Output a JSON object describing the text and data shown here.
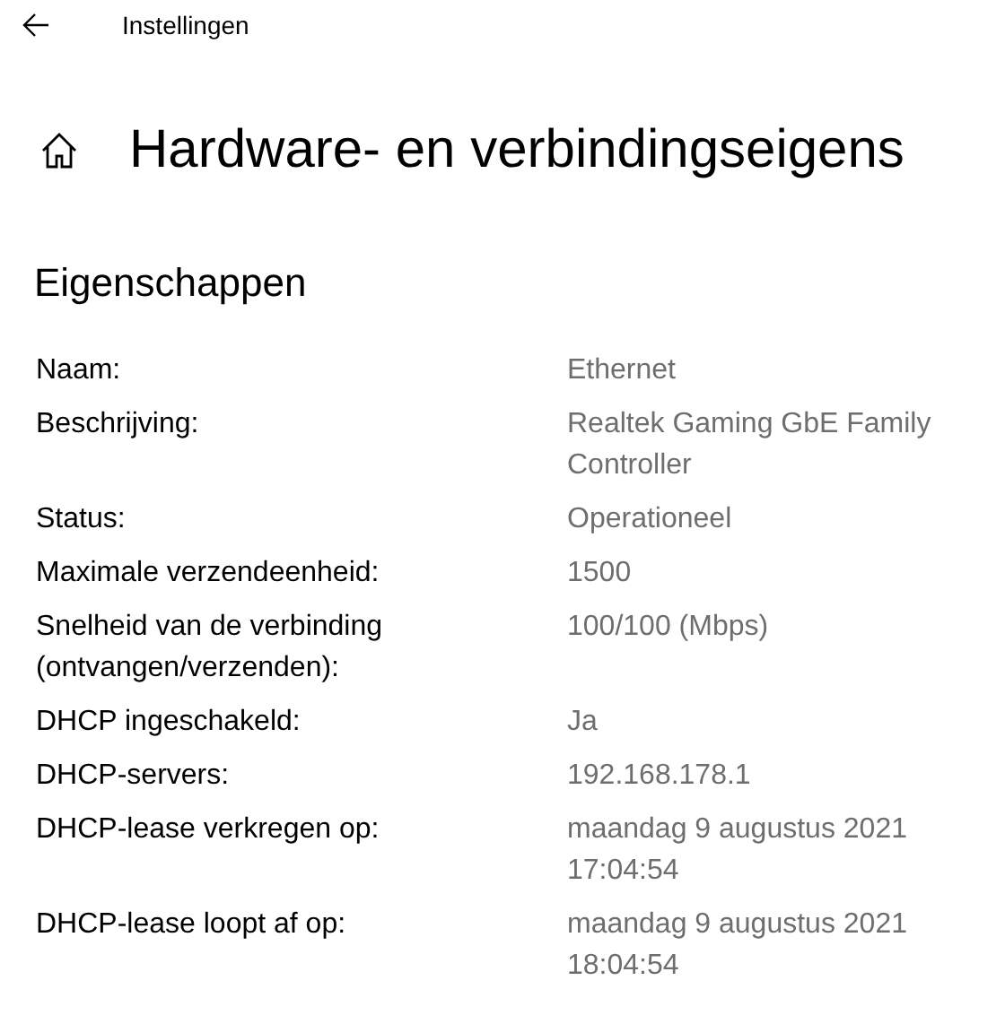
{
  "header": {
    "title": "Instellingen"
  },
  "page": {
    "title": "Hardware- en verbindingseigens"
  },
  "section": {
    "title": "Eigenschappen"
  },
  "properties": [
    {
      "label": "Naam:",
      "value": "Ethernet"
    },
    {
      "label": "Beschrijving:",
      "value": "Realtek Gaming GbE Family Controller"
    },
    {
      "label": "Status:",
      "value": "Operationeel"
    },
    {
      "label": "Maximale verzendeenheid:",
      "value": "1500"
    },
    {
      "label": "Snelheid van de verbinding (ontvangen/verzenden):",
      "value": "100/100 (Mbps)"
    },
    {
      "label": "DHCP ingeschakeld:",
      "value": "Ja"
    },
    {
      "label": "DHCP-servers:",
      "value": "192.168.178.1"
    },
    {
      "label": "DHCP-lease verkregen op:",
      "value": "maandag 9 augustus 2021 17:04:54"
    },
    {
      "label": "DHCP-lease loopt af op:",
      "value": "maandag 9 augustus 2021 18:04:54"
    }
  ]
}
